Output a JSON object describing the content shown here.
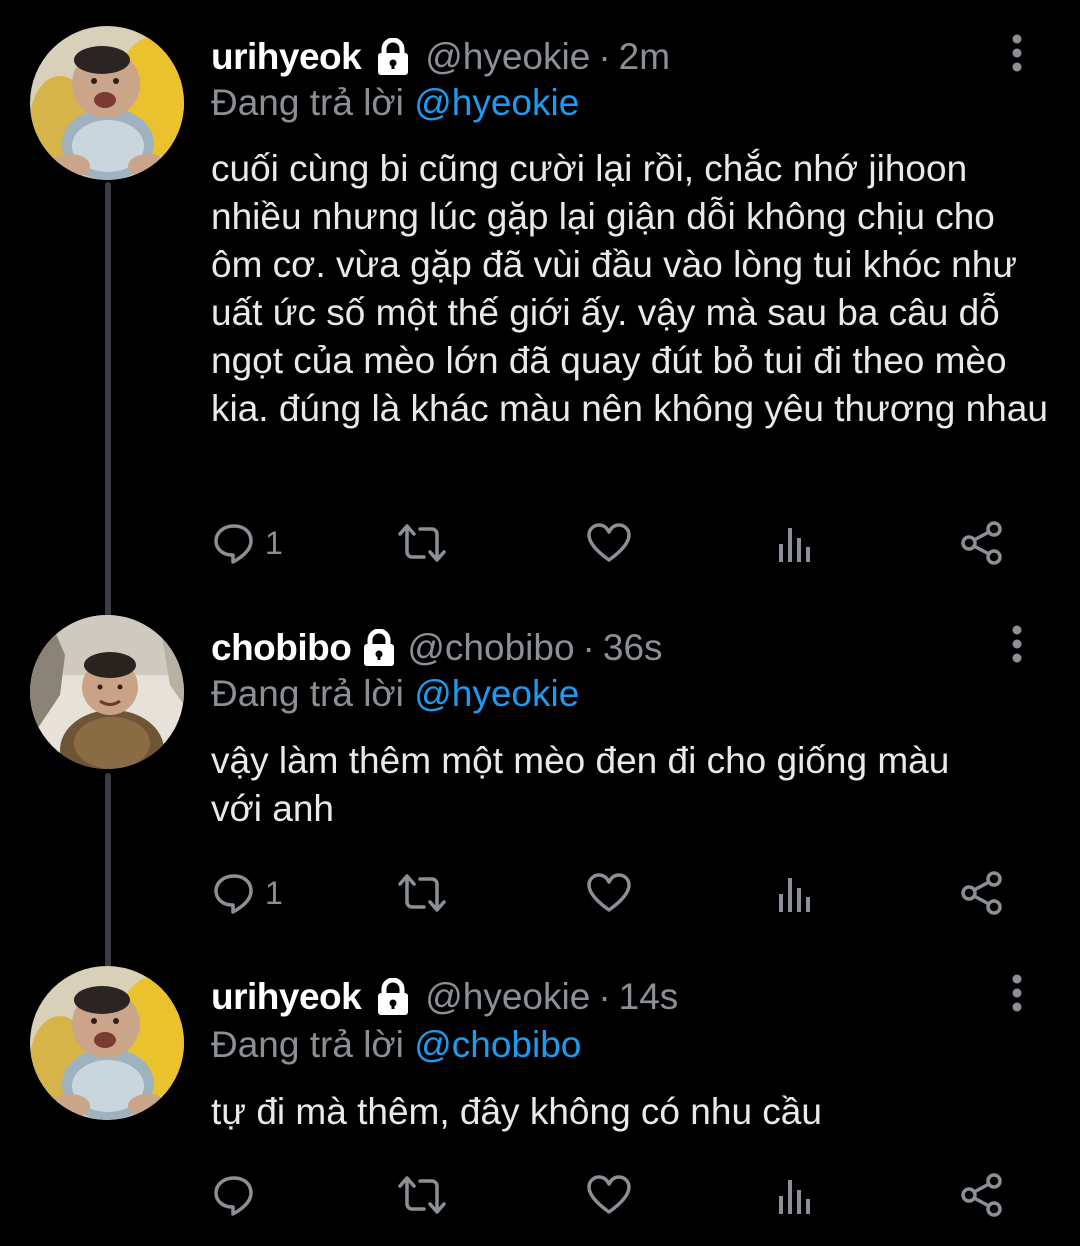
{
  "thread": {
    "tweets": [
      {
        "author_name": "urihyeok",
        "handle": "@hyeokie",
        "separator": "·",
        "time": "2m",
        "reply_prefix": "Đang trả lời",
        "reply_to": "@hyeokie",
        "text": "cuối cùng bi cũng cười lại rồi, chắc nhớ jihoon nhiều nhưng lúc gặp lại giận dỗi không chịu cho ôm cơ. vừa gặp đã vùi đầu vào lòng tui khóc như uất ức số một thế giới ấy. vậy mà sau ba câu dỗ ngọt của mèo lớn đã quay đút bỏ tui đi theo mèo kia. đúng là khác màu nên không yêu thương nhau",
        "reply_count": "1",
        "avatar": "baby-photo"
      },
      {
        "author_name": "chobibo",
        "handle": "@chobibo",
        "separator": "·",
        "time": "36s",
        "reply_prefix": "Đang trả lời",
        "reply_to": "@hyeokie",
        "text": "vậy làm thêm một mèo đen đi cho giống màu với anh",
        "reply_count": "1",
        "avatar": "child-in-snow-photo"
      },
      {
        "author_name": "urihyeok",
        "handle": "@hyeokie",
        "separator": "·",
        "time": "14s",
        "reply_prefix": "Đang trả lời",
        "reply_to": "@chobibo",
        "text": "tự đi mà thêm, đây không có nhu cầu",
        "reply_count": "",
        "avatar": "baby-photo"
      }
    ]
  },
  "icons": {
    "lock": "lock-icon",
    "more": "more-vertical-icon",
    "reply": "reply-icon",
    "retweet": "retweet-icon",
    "like": "heart-icon",
    "views": "analytics-icon",
    "share": "share-icon"
  },
  "colors": {
    "background": "#000000",
    "primary_text": "#e7e9ea",
    "secondary_text": "#8b9096",
    "mention": "#1d9bf0",
    "thread_line": "#3a3d41"
  }
}
